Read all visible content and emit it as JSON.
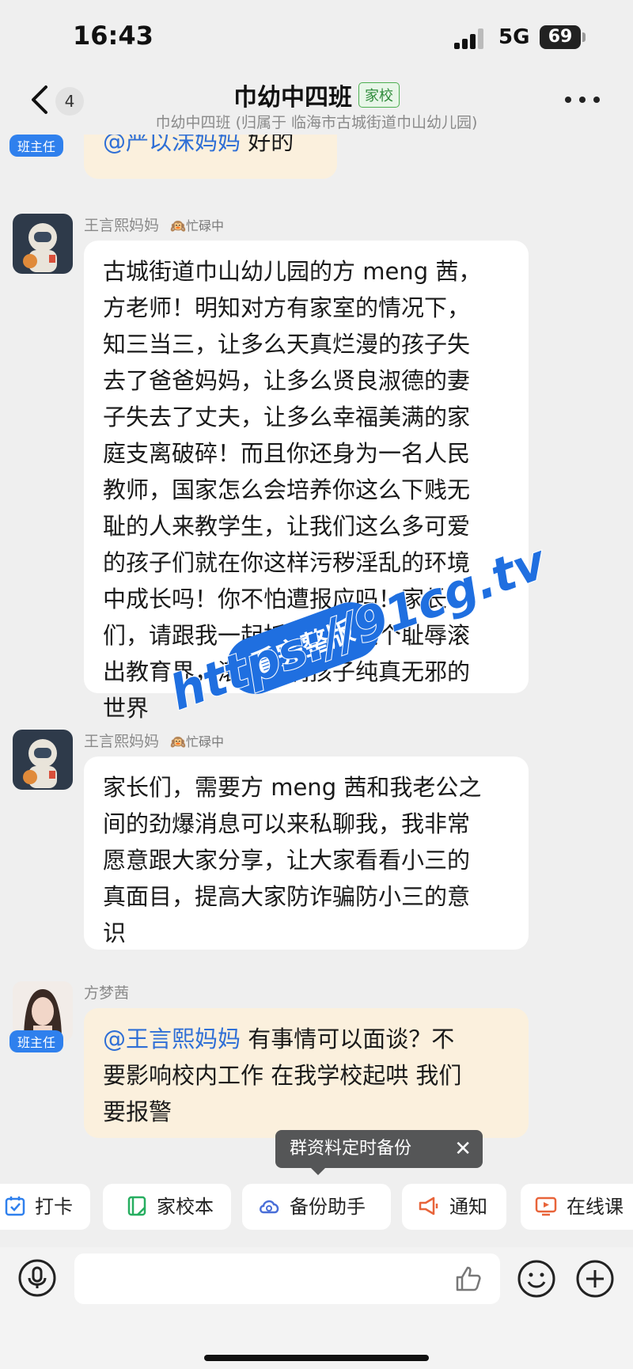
{
  "status_bar": {
    "time": "16:43",
    "network": "5G",
    "battery": "69"
  },
  "header": {
    "unread_count": "4",
    "title": "巾幼中四班",
    "tag": "家校",
    "subtitle": "巾幼中四班 (归属于 临海市古城街道巾山幼儿园)"
  },
  "messages": [
    {
      "role_badge": "班主任",
      "mention": "@严以沫妈妈",
      "text": " 好的"
    },
    {
      "sender": "王言熙妈妈",
      "status": "忙碌中",
      "lines": [
        "古城街道巾山幼儿园的方 meng 茜，",
        "方老师！明知对方有家室的情况下，",
        "知三当三，让多么天真烂漫的孩子失",
        "去了爸爸妈妈，让多么贤良淑德的妻",
        "子失去了丈夫，让多么幸福美满的家",
        "庭支离破碎！而且你还身为一名人民",
        "教师，国家怎么会培养你这么下贱无",
        "耻的人来教学生，让我们这么多可爱",
        "的孩子们就在你这样污秽淫乱的环境",
        "中成长吗！你不怕遭报应吗！家长",
        "们，请跟我一起抵制，让这个耻辱滚",
        "出教育界，滚出我们孩子纯真无邪的",
        "世界"
      ]
    },
    {
      "sender": "王言熙妈妈",
      "status": "忙碌中",
      "lines": [
        "家长们，需要方 meng 茜和我老公之",
        "间的劲爆消息可以来私聊我，我非常",
        "愿意跟大家分享，让大家看看小三的",
        "真面目，提高大家防诈骗防小三的意",
        "识"
      ]
    },
    {
      "sender": "方梦茜",
      "role_badge": "班主任",
      "mention": "@王言熙妈妈",
      "lines": [
        " 有事情可以面谈？不",
        "要影响校内工作  在我学校起哄  我们",
        "要报警"
      ]
    }
  ],
  "tooltip": {
    "text": "群资料定时备份",
    "close": "✕"
  },
  "toolbar": {
    "items": [
      {
        "label": "打卡",
        "icon": "checkin-icon"
      },
      {
        "label": "家校本",
        "icon": "notebook-icon"
      },
      {
        "label": "备份助手",
        "icon": "cloud-backup-icon"
      },
      {
        "label": "通知",
        "icon": "megaphone-icon"
      },
      {
        "label": "在线课",
        "icon": "live-class-icon"
      }
    ]
  },
  "input_bar": {
    "placeholder": ""
  },
  "watermark": {
    "badge": "看完整版",
    "url": "https://91cg.tv"
  },
  "colors": {
    "accent": "#2f80ed",
    "bubble_yellow": "#fbf0dd",
    "watermark_blue": "#1f6fe0"
  }
}
